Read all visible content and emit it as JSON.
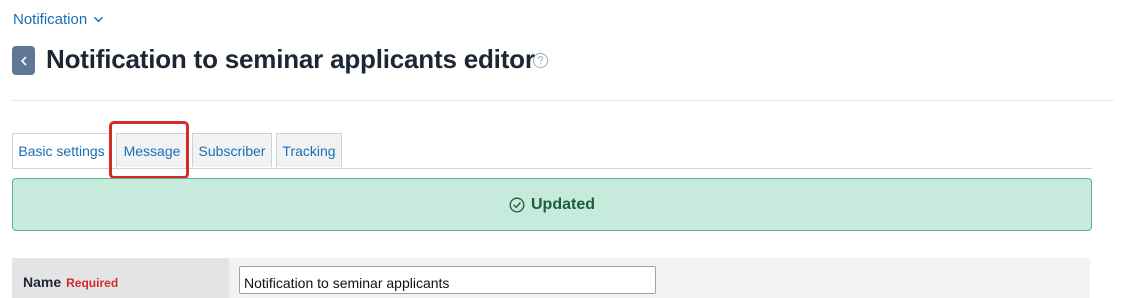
{
  "breadcrumb": {
    "label": "Notification"
  },
  "header": {
    "title": "Notification to seminar applicants editor"
  },
  "tabs": [
    {
      "label": "Basic settings",
      "active": true
    },
    {
      "label": "Message",
      "active": false,
      "highlighted": true
    },
    {
      "label": "Subscriber",
      "active": false
    },
    {
      "label": "Tracking",
      "active": false
    }
  ],
  "alert": {
    "message": "Updated",
    "type": "success"
  },
  "form": {
    "name_label": "Name",
    "required_label": "Required",
    "name_value": "Notification to seminar applicants"
  },
  "colors": {
    "link": "#1a6fb5",
    "back_button": "#5f7794",
    "success_bg": "#c6eadc",
    "success_border": "#5eb48d",
    "highlight": "#d42a2a"
  },
  "icons": {
    "breadcrumb": "chevron-down-icon",
    "back": "chevron-left-icon",
    "help": "question-circle-icon",
    "alert": "check-circle-icon"
  }
}
